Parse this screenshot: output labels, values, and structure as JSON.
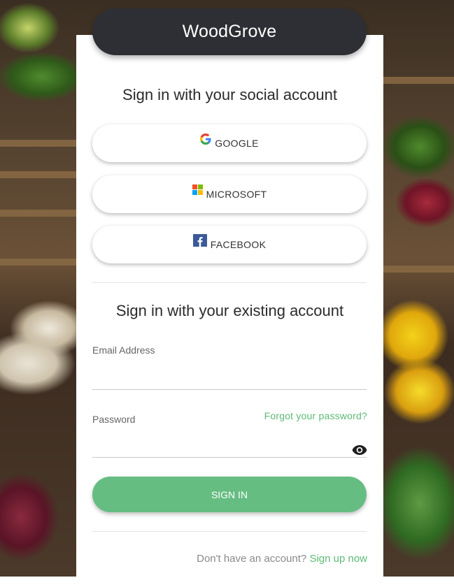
{
  "brand": {
    "title": "WoodGrove"
  },
  "social": {
    "heading": "Sign in with your social account",
    "buttons": [
      {
        "label": "GOOGLE",
        "icon": "google-icon"
      },
      {
        "label": "MICROSOFT",
        "icon": "microsoft-icon"
      },
      {
        "label": "FACEBOOK",
        "icon": "facebook-icon"
      }
    ]
  },
  "local": {
    "heading": "Sign in with your existing account",
    "email_label": "Email Address",
    "email_value": "",
    "password_label": "Password",
    "password_value": "",
    "forgot_link": "Forgot your password?",
    "eye_icon": "eye-icon",
    "signin_label": "SIGN IN"
  },
  "footer": {
    "prompt": "Don't have an account?",
    "signup_link": "Sign up now"
  },
  "colors": {
    "header_bg": "#2d2f34",
    "accent": "#66bd82",
    "link": "#5dba75"
  }
}
